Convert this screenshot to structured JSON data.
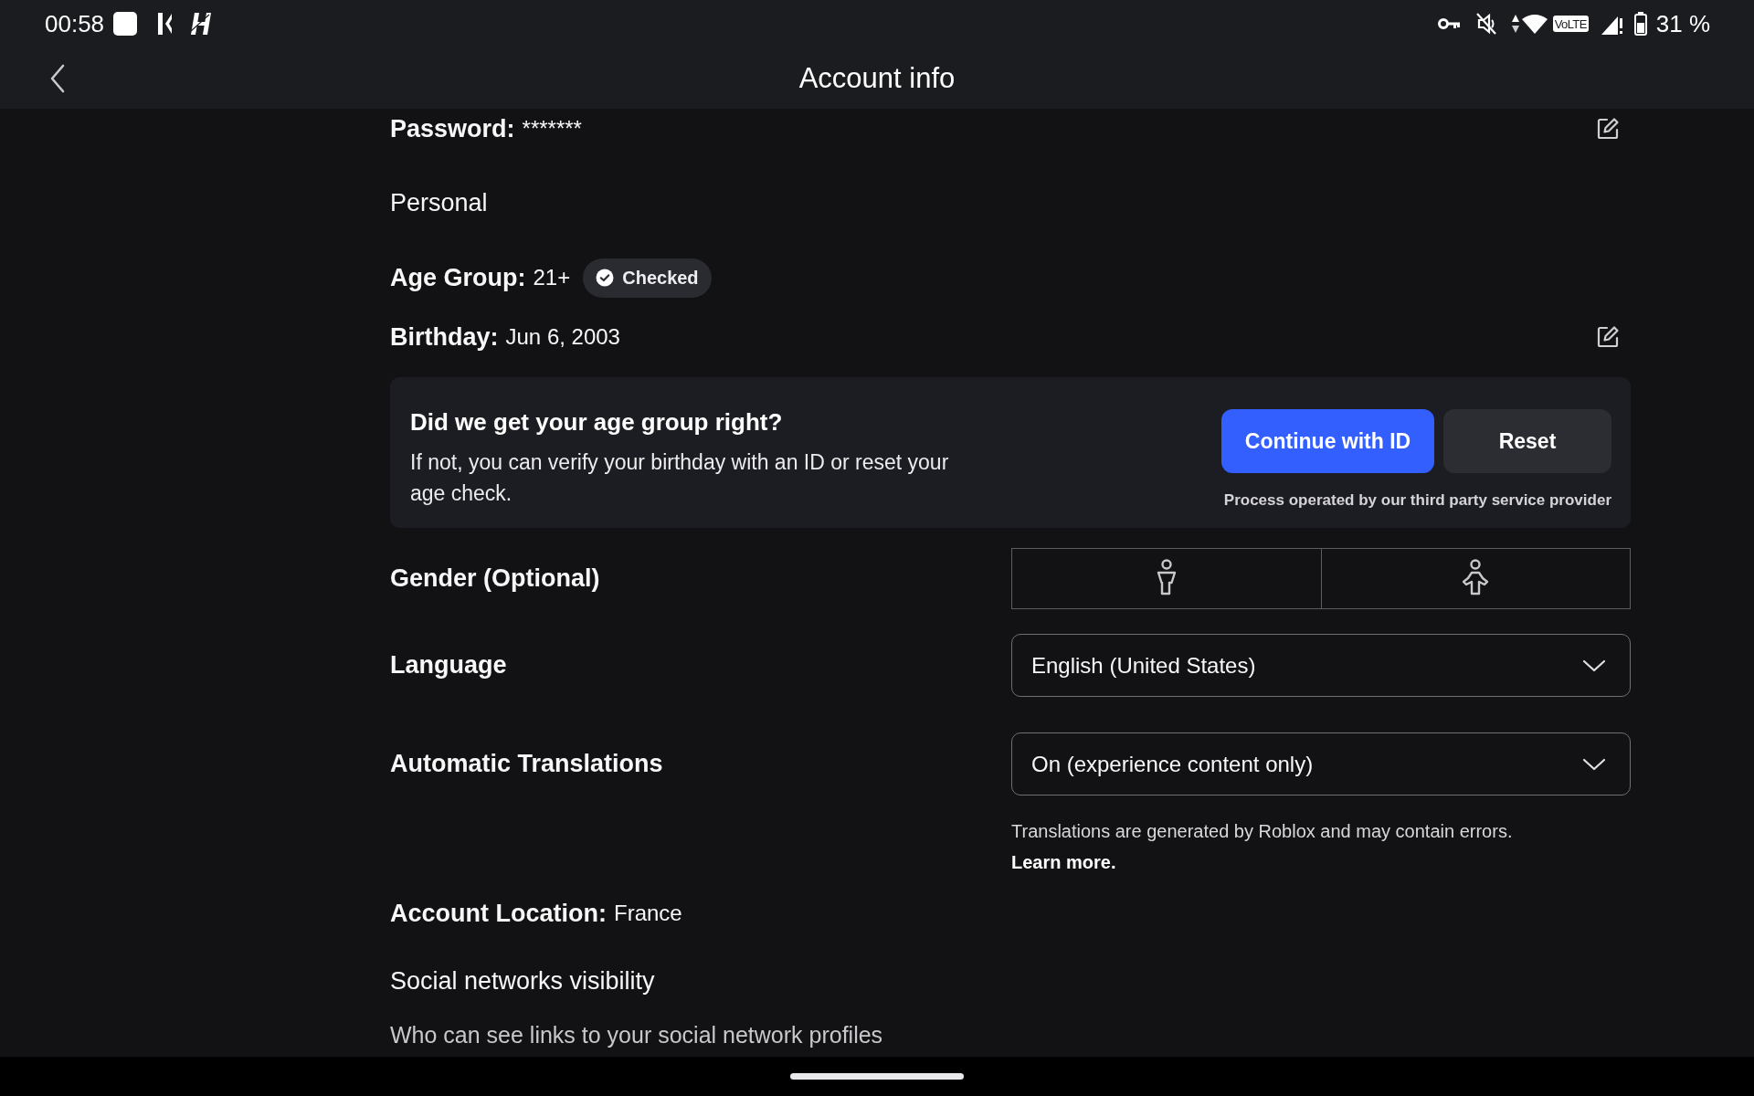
{
  "status_bar": {
    "time": "00:58",
    "network_label": "VoLTE",
    "battery": "31 %"
  },
  "header": {
    "title": "Account info"
  },
  "account_fields": [
    {
      "kind": "field",
      "label": "Password:",
      "value": "*******",
      "editable": true
    },
    {
      "kind": "heading",
      "label": "Personal"
    },
    {
      "kind": "field",
      "label": "Age Group:",
      "value": "21+",
      "badge": "Checked"
    },
    {
      "kind": "field",
      "label": "Birthday:",
      "value": "Jun 6, 2003",
      "editable": true
    }
  ],
  "age_check": {
    "title": "Did we get your age group right?",
    "text": "If not, you can verify your birthday with an ID or reset your age check.",
    "buttons": [
      {
        "label": "Continue with ID",
        "kind": "primary"
      },
      {
        "label": "Reset",
        "kind": "secondary"
      }
    ],
    "note": "Process operated by our third party service provider"
  },
  "settings": [
    {
      "kind": "gender",
      "label": "Gender (Optional)",
      "options": [
        {
          "kind": "male",
          "selected": false
        },
        {
          "kind": "female",
          "selected": false
        }
      ]
    },
    {
      "kind": "select",
      "label": "Language",
      "value": "English (United States)"
    },
    {
      "kind": "select",
      "label": "Automatic Translations",
      "value": "On (experience content only)",
      "note": "Translations are generated by Roblox and may contain errors.",
      "link": "Learn more."
    }
  ],
  "location": {
    "label": "Account Location:",
    "value": "France"
  },
  "social": {
    "title": "Social networks visibility",
    "subtitle": "Who can see links to your social network profiles"
  }
}
